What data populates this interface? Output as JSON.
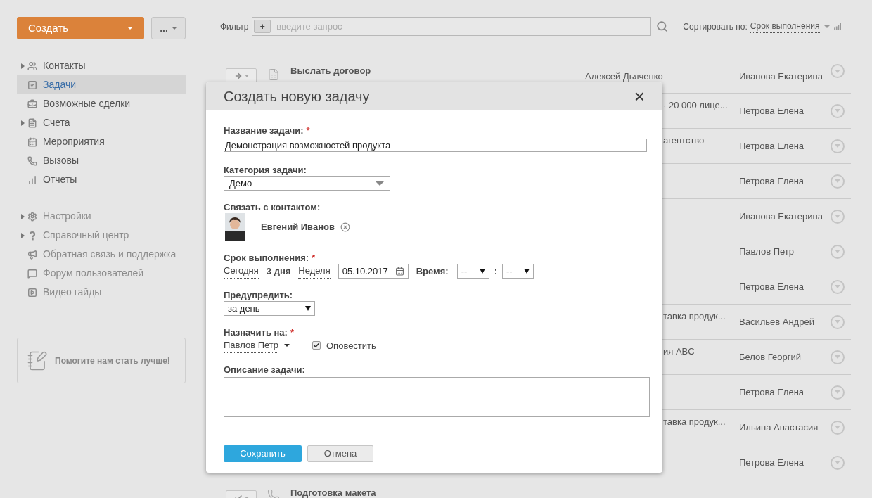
{
  "sidebar": {
    "create_button": "Создать",
    "more_button": "...",
    "nav": [
      {
        "label": "Контакты",
        "expandable": true,
        "selected": false
      },
      {
        "label": "Задачи",
        "expandable": false,
        "selected": true
      },
      {
        "label": "Возможные сделки",
        "expandable": false,
        "selected": false
      },
      {
        "label": "Счета",
        "expandable": true,
        "selected": false
      },
      {
        "label": "Мероприятия",
        "expandable": false,
        "selected": false
      },
      {
        "label": "Вызовы",
        "expandable": false,
        "selected": false
      },
      {
        "label": "Отчеты",
        "expandable": false,
        "selected": false
      }
    ],
    "help_nav": [
      {
        "label": "Настройки",
        "expandable": true
      },
      {
        "label": "Справочный центр",
        "expandable": true
      },
      {
        "label": "Обратная связь и поддержка",
        "expandable": false
      },
      {
        "label": "Форум пользователей",
        "expandable": false
      },
      {
        "label": "Видео гайды",
        "expandable": false
      }
    ],
    "feedback_card": "Помогите нам стать лучше!"
  },
  "toolbar": {
    "filter_label": "Фильтр",
    "filter_add": "+",
    "filter_placeholder": "введите запрос",
    "sort_label": "Сортировать по:",
    "sort_value": "Срок выполнения"
  },
  "rows": [
    {
      "kind": "full",
      "title": "Выслать договор",
      "contact": "Алексей Дьяченко",
      "responsible": "Иванова Екатерина"
    },
    {
      "kind": "covered",
      "contact": "· 20 000 лице...",
      "responsible": "Петрова Елена"
    },
    {
      "kind": "covered",
      "contact": "агентство",
      "responsible": "Петрова Елена"
    },
    {
      "kind": "covered",
      "responsible": "Петрова Елена"
    },
    {
      "kind": "covered",
      "responsible": "Иванова Екатерина"
    },
    {
      "kind": "covered",
      "responsible": "Павлов Петр"
    },
    {
      "kind": "covered",
      "responsible": "Петрова Елена"
    },
    {
      "kind": "covered",
      "contact": "тавка продук...",
      "responsible": "Васильев Андрей"
    },
    {
      "kind": "covered",
      "contact": "ия ABC",
      "responsible": "Белов Георгий"
    },
    {
      "kind": "covered",
      "responsible": "Петрова Елена"
    },
    {
      "kind": "covered",
      "contact": "тавка продук...",
      "responsible": "Ильина Анастасия"
    },
    {
      "kind": "covered",
      "responsible": "Петрова Елена"
    },
    {
      "kind": "full",
      "title": "Подготовка макета"
    }
  ],
  "dialog": {
    "title": "Создать новую задачу",
    "close": "×",
    "name_label": "Название задачи:",
    "required_mark": "*",
    "name_value": "Демонстрация возможностей продукта",
    "category_label": "Категория задачи:",
    "category_value": "Демо",
    "contact_label": "Связать с контактом:",
    "contact_name": "Евгений Иванов",
    "deadline_label": "Срок выполнения:",
    "deadline_options": [
      {
        "label": "Сегодня",
        "selected": false
      },
      {
        "label": "3 дня",
        "selected": true
      },
      {
        "label": "Неделя",
        "selected": false
      }
    ],
    "date_value": "05.10.2017",
    "time_label": "Время:",
    "hour_value": "--",
    "time_sep": ":",
    "minute_value": "--",
    "remind_label": "Предупредить:",
    "remind_value": "за день",
    "assign_label": "Назначить на:",
    "assign_value": "Павлов Петр",
    "notify_label": "Оповестить",
    "notify_checked": true,
    "description_label": "Описание задачи:",
    "save_button": "Сохранить",
    "cancel_button": "Отмена"
  }
}
